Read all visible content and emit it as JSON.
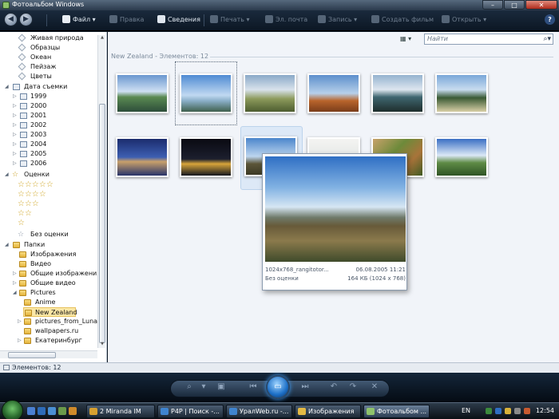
{
  "window": {
    "title": "Фотоальбом Windows",
    "minimize": "–",
    "maximize": "□",
    "close": "✕"
  },
  "toolbar": {
    "back": "◀",
    "forward": "▶",
    "items": [
      {
        "label": "Файл ▾",
        "icon": "file-icon"
      },
      {
        "label": "Правка",
        "icon": "edit-icon"
      },
      {
        "label": "Сведения",
        "icon": "info-icon"
      },
      {
        "label": "Печать ▾",
        "icon": "print-icon"
      },
      {
        "label": "Эл. почта",
        "icon": "mail-icon"
      },
      {
        "label": "Запись ▾",
        "icon": "burn-icon"
      },
      {
        "label": "Создать фильм",
        "icon": "movie-icon"
      },
      {
        "label": "Открыть ▾",
        "icon": "open-icon"
      }
    ],
    "help": "?"
  },
  "sidebar": {
    "tags": [
      "Живая природа",
      "Образцы",
      "Океан",
      "Пейзаж",
      "Цветы"
    ],
    "date_header": "Дата съемки",
    "years": [
      "1999",
      "2000",
      "2001",
      "2002",
      "2003",
      "2004",
      "2005",
      "2006"
    ],
    "ratings_header": "Оценки",
    "rating_levels": [
      5,
      4,
      3,
      2,
      1
    ],
    "no_rating": "Без оценки",
    "folders_header": "Папки",
    "folders": [
      "Изображения",
      "Видео",
      "Общие изображения",
      "Общие видео"
    ],
    "pictures": "Pictures",
    "subfolders": [
      "Anime",
      "New Zealand",
      "pictures_from_Luna",
      "wallpapers.ru",
      "Екатеринбург"
    ]
  },
  "main": {
    "search_placeholder": "Найти",
    "group_header": "New Zealand - Элементов: 12"
  },
  "popup": {
    "filename": "1024x768_rangitotor...",
    "date": "06.08.2005 11:21",
    "rating": "Без оценки",
    "size": "164 КБ (1024 x 768)"
  },
  "status": {
    "text": "Элементов: 12"
  },
  "taskbar": {
    "tasks": [
      "2 Miranda IM",
      "P4P | Поиск -...",
      "УралWeb.ru -...",
      "Изображения",
      "Фотоальбом ..."
    ],
    "lang": "EN",
    "clock": "12:54"
  },
  "colors": {
    "accent": "#1c6fc7",
    "toolbar_bg": "#0c1724",
    "selection": "#fbe7a6"
  }
}
